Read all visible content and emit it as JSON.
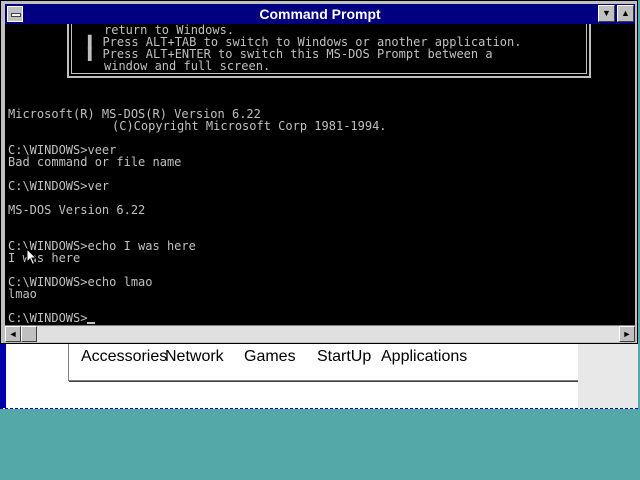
{
  "window": {
    "title": "Command Prompt",
    "minimize_glyph": "▼",
    "maximize_glyph": "▲"
  },
  "console": {
    "lines": [
      "return to Windows.",
      "▌ Press ALT+TAB to switch to Windows or another application.",
      "▌ Press ALT+ENTER to switch this MS-DOS Prompt between a",
      "window and full screen.",
      "Microsoft(R) MS-DOS(R) Version 6.22",
      "(C)Copyright Microsoft Corp 1981-1994.",
      "C:\\WINDOWS>veer",
      "Bad command or file name",
      "C:\\WINDOWS>ver",
      "MS-DOS Version 6.22",
      "C:\\WINDOWS>echo I was here",
      "I was here",
      "C:\\WINDOWS>echo lmao",
      "lmao",
      "C:\\WINDOWS>"
    ]
  },
  "scrollbar": {
    "left_glyph": "◄",
    "right_glyph": "►"
  },
  "program_manager": {
    "groups": [
      "Accessories",
      "Network",
      "Games",
      "StartUp",
      "Applications"
    ]
  },
  "colors": {
    "desktop": "#55a8a8",
    "titlebar": "#000080",
    "console_bg": "#000000",
    "console_text": "#c0c0c0"
  }
}
